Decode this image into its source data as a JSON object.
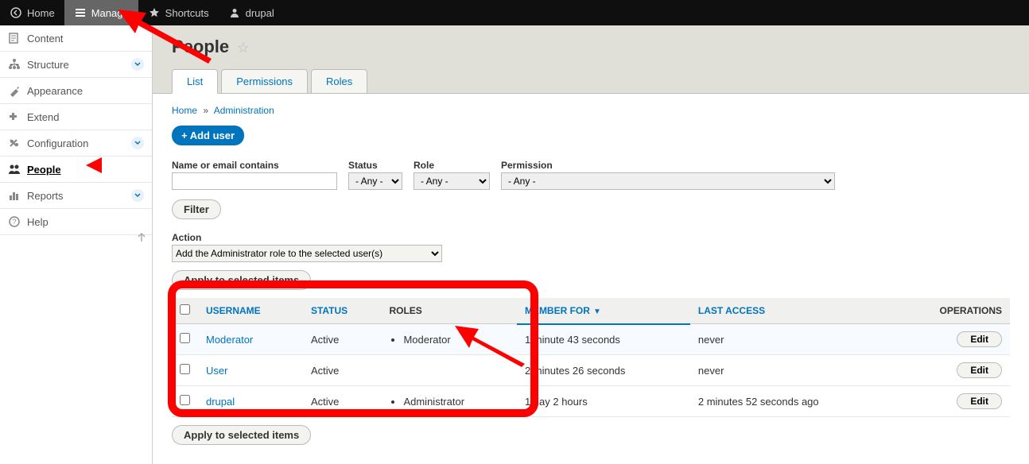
{
  "toolbar": {
    "home": "Home",
    "manage": "Manage",
    "shortcuts": "Shortcuts",
    "user": "drupal"
  },
  "sidebar": {
    "items": [
      {
        "label": "Content",
        "icon": "content"
      },
      {
        "label": "Structure",
        "icon": "structure",
        "expand": true
      },
      {
        "label": "Appearance",
        "icon": "appearance"
      },
      {
        "label": "Extend",
        "icon": "extend"
      },
      {
        "label": "Configuration",
        "icon": "config",
        "expand": true
      },
      {
        "label": "People",
        "icon": "people",
        "active": true
      },
      {
        "label": "Reports",
        "icon": "reports",
        "expand": true
      },
      {
        "label": "Help",
        "icon": "help"
      }
    ]
  },
  "page": {
    "title": "People"
  },
  "tabs": [
    {
      "label": "List",
      "active": true
    },
    {
      "label": "Permissions"
    },
    {
      "label": "Roles"
    }
  ],
  "breadcrumb": {
    "home": "Home",
    "admin": "Administration"
  },
  "buttons": {
    "add_user": "+ Add user",
    "filter": "Filter",
    "apply": "Apply to selected items",
    "apply2": "Apply to selected items",
    "edit": "Edit"
  },
  "filters": {
    "name_label": "Name or email contains",
    "status_label": "Status",
    "role_label": "Role",
    "permission_label": "Permission",
    "any": "- Any -"
  },
  "action": {
    "label": "Action",
    "value": "Add the Administrator role to the selected user(s)"
  },
  "columns": {
    "username": "USERNAME",
    "status": "STATUS",
    "roles": "ROLES",
    "member_for": "MEMBER FOR",
    "last_access": "LAST ACCESS",
    "operations": "OPERATIONS"
  },
  "rows": [
    {
      "username": "Moderator",
      "status": "Active",
      "roles": [
        "Moderator"
      ],
      "member_for": "1 minute 43 seconds",
      "last_access": "never"
    },
    {
      "username": "User",
      "status": "Active",
      "roles": [],
      "member_for": "2 minutes 26 seconds",
      "last_access": "never"
    },
    {
      "username": "drupal",
      "status": "Active",
      "roles": [
        "Administrator"
      ],
      "member_for": "1 day 2 hours",
      "last_access": "2 minutes 52 seconds ago"
    }
  ]
}
